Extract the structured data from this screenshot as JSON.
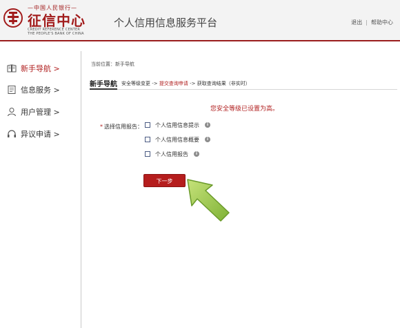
{
  "header": {
    "logo_top_text": "—中国人民银行—",
    "logo_cn": "征信中心",
    "logo_en_line1": "CREDIT REFERENCE CENTER",
    "logo_en_line2": "THE PEOPLE'S BANK OF CHINA",
    "platform_title": "个人信用信息服务平台",
    "logout_label": "退出",
    "separator": "|",
    "help_label": "帮助中心"
  },
  "sidebar": {
    "items": [
      {
        "label": "新手导航 >",
        "icon": "book-icon",
        "active": true
      },
      {
        "label": "信息服务 >",
        "icon": "document-icon",
        "active": false
      },
      {
        "label": "用户管理 >",
        "icon": "user-icon",
        "active": false
      },
      {
        "label": "异议申请 >",
        "icon": "headset-icon",
        "active": false
      }
    ]
  },
  "main": {
    "breadcrumb": "当前位置：新手导航",
    "guide_title": "新手导航",
    "steps": {
      "step1": "安全等级变更 ->",
      "step2": "提交查询申请",
      "step3": "-> 获取查询结果（非实时）"
    },
    "notice": "您安全等级已设置为高。",
    "field_label": "选择信用报告：",
    "required_mark": "*",
    "options": [
      {
        "label": "个人信用信息提示",
        "checked": false
      },
      {
        "label": "个人信用信息概要",
        "checked": false
      },
      {
        "label": "个人信用报告",
        "checked": false
      }
    ],
    "next_button": "下一步"
  },
  "colors": {
    "brand_red": "#b01f1f",
    "arrow_green": "#8cc63f"
  }
}
